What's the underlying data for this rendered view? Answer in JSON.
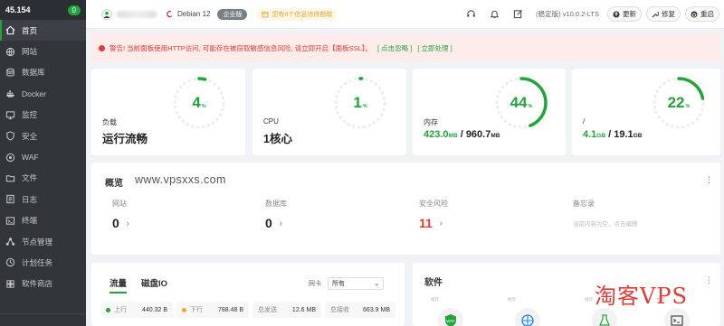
{
  "sidebar": {
    "ip": "45.154",
    "badge": "0",
    "items": [
      {
        "label": "首页",
        "icon": "home-icon"
      },
      {
        "label": "网站",
        "icon": "globe-icon"
      },
      {
        "label": "数据库",
        "icon": "database-icon"
      },
      {
        "label": "Docker",
        "icon": "docker-icon"
      },
      {
        "label": "监控",
        "icon": "monitor-icon"
      },
      {
        "label": "安全",
        "icon": "shield-icon"
      },
      {
        "label": "WAF",
        "icon": "waf-icon"
      },
      {
        "label": "文件",
        "icon": "folder-icon"
      },
      {
        "label": "日志",
        "icon": "log-icon"
      },
      {
        "label": "终端",
        "icon": "terminal-icon"
      },
      {
        "label": "节点管理",
        "icon": "node-icon"
      },
      {
        "label": "计划任务",
        "icon": "clock-icon"
      },
      {
        "label": "软件商店",
        "icon": "store-icon"
      }
    ]
  },
  "topbar": {
    "os": "Debian 12",
    "edition": "企业版",
    "notice": "您有4个信息待待额取",
    "version": "(稳定版) v10.0.2-LTS",
    "buttons": {
      "update": "更新",
      "repair": "修复",
      "restart": "重启"
    }
  },
  "alert": {
    "text": "警告! 当前面板使用HTTP访问, 可能存在被窃取敏感信息风险, 请立即开启【面板SSL】。",
    "link1": "[ 点击忽略 ]",
    "link2": "[ 立即处理 ]"
  },
  "stats": [
    {
      "label": "负载",
      "percent": "4",
      "value": "运行流畅"
    },
    {
      "label": "CPU",
      "percent": "1",
      "value": "1核心"
    },
    {
      "label": "内存",
      "percent": "44",
      "used": "423.0",
      "used_unit": "MB",
      "sep": " / ",
      "total": "960.7",
      "total_unit": "MB"
    },
    {
      "label": "/",
      "percent": "22",
      "used": "4.1",
      "used_unit": "GB",
      "sep": " / ",
      "total": "19.1",
      "total_unit": "GB"
    }
  ],
  "overview": {
    "title": "概览",
    "watermark": "www.vpsxxs.com",
    "more": "⋮",
    "items": [
      {
        "label": "网站",
        "value": "0",
        "arrow": "›"
      },
      {
        "label": "数据库",
        "value": "0",
        "arrow": "›"
      },
      {
        "label": "安全风险",
        "value": "11",
        "arrow": "›"
      },
      {
        "label": "备忘录",
        "memo": "当前内容为空，点击编辑"
      }
    ]
  },
  "traffic": {
    "tab_flow": "流量",
    "tab_io": "磁盘IO",
    "nic_label": "网卡",
    "nic_value": "所有",
    "cells": [
      {
        "label": "上行",
        "value": "440.32 B",
        "dot": "#20a53a"
      },
      {
        "label": "下行",
        "value": "788.48 B",
        "dot": "#f5a623"
      },
      {
        "label": "总发送",
        "value": "12.6 MB"
      },
      {
        "label": "总接收",
        "value": "663.9 MB"
      }
    ]
  },
  "software": {
    "title": "软件",
    "more": "⋮",
    "tile_tag": "推荐",
    "tiles": [
      "waf-logo-icon",
      "globe-cross-icon",
      "flask-icon",
      "terminal-window-icon"
    ]
  },
  "watermark2": "淘客VPS",
  "colors": {
    "accent": "#20a53a",
    "danger": "#e53935",
    "sidebar": "#32353a"
  }
}
